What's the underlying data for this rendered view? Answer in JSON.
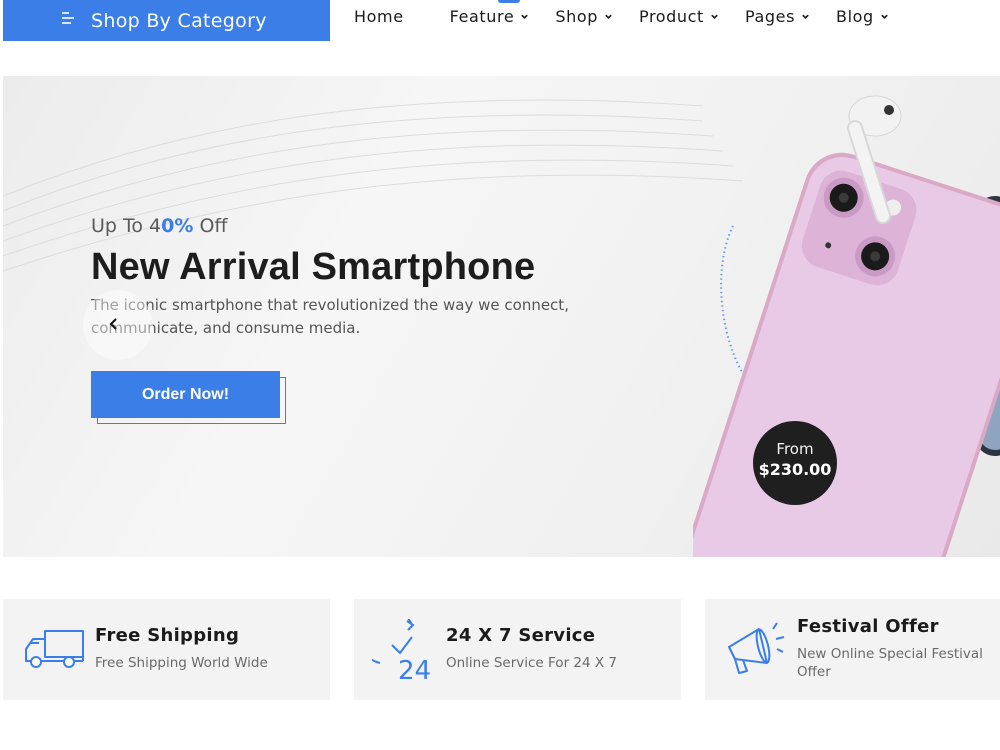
{
  "nav": {
    "category_label": "Shop By Category",
    "items": [
      {
        "label": "Home",
        "has_dropdown": false
      },
      {
        "label": "Feature",
        "has_dropdown": true
      },
      {
        "label": "Shop",
        "has_dropdown": true
      },
      {
        "label": "Product",
        "has_dropdown": true
      },
      {
        "label": "Pages",
        "has_dropdown": true
      },
      {
        "label": "Blog",
        "has_dropdown": true
      }
    ]
  },
  "hero": {
    "eyebrow_prefix": "Up To 4",
    "eyebrow_highlight": "0%",
    "eyebrow_suffix": " Off",
    "title": "New Arrival Smartphone",
    "description": "The iconic smartphone that revolutionized the way we connect, communicate, and consume media.",
    "cta_label": "Order Now!",
    "price_from": "From",
    "price_value": "$230.00"
  },
  "features": [
    {
      "icon": "delivery-truck-icon",
      "title": "Free Shipping",
      "description": "Free Shipping World Wide"
    },
    {
      "icon": "clock-24-icon",
      "title": "24 X 7 Service",
      "description": "Online Service For 24 X 7"
    },
    {
      "icon": "megaphone-icon",
      "title": "Festival Offer",
      "description": "New Online Special Festival Offer"
    }
  ],
  "colors": {
    "accent": "#3b7ee8",
    "dark": "#1f1f1f",
    "card_bg": "#f3f3f3",
    "phone_pink": "#e7c7e6"
  }
}
